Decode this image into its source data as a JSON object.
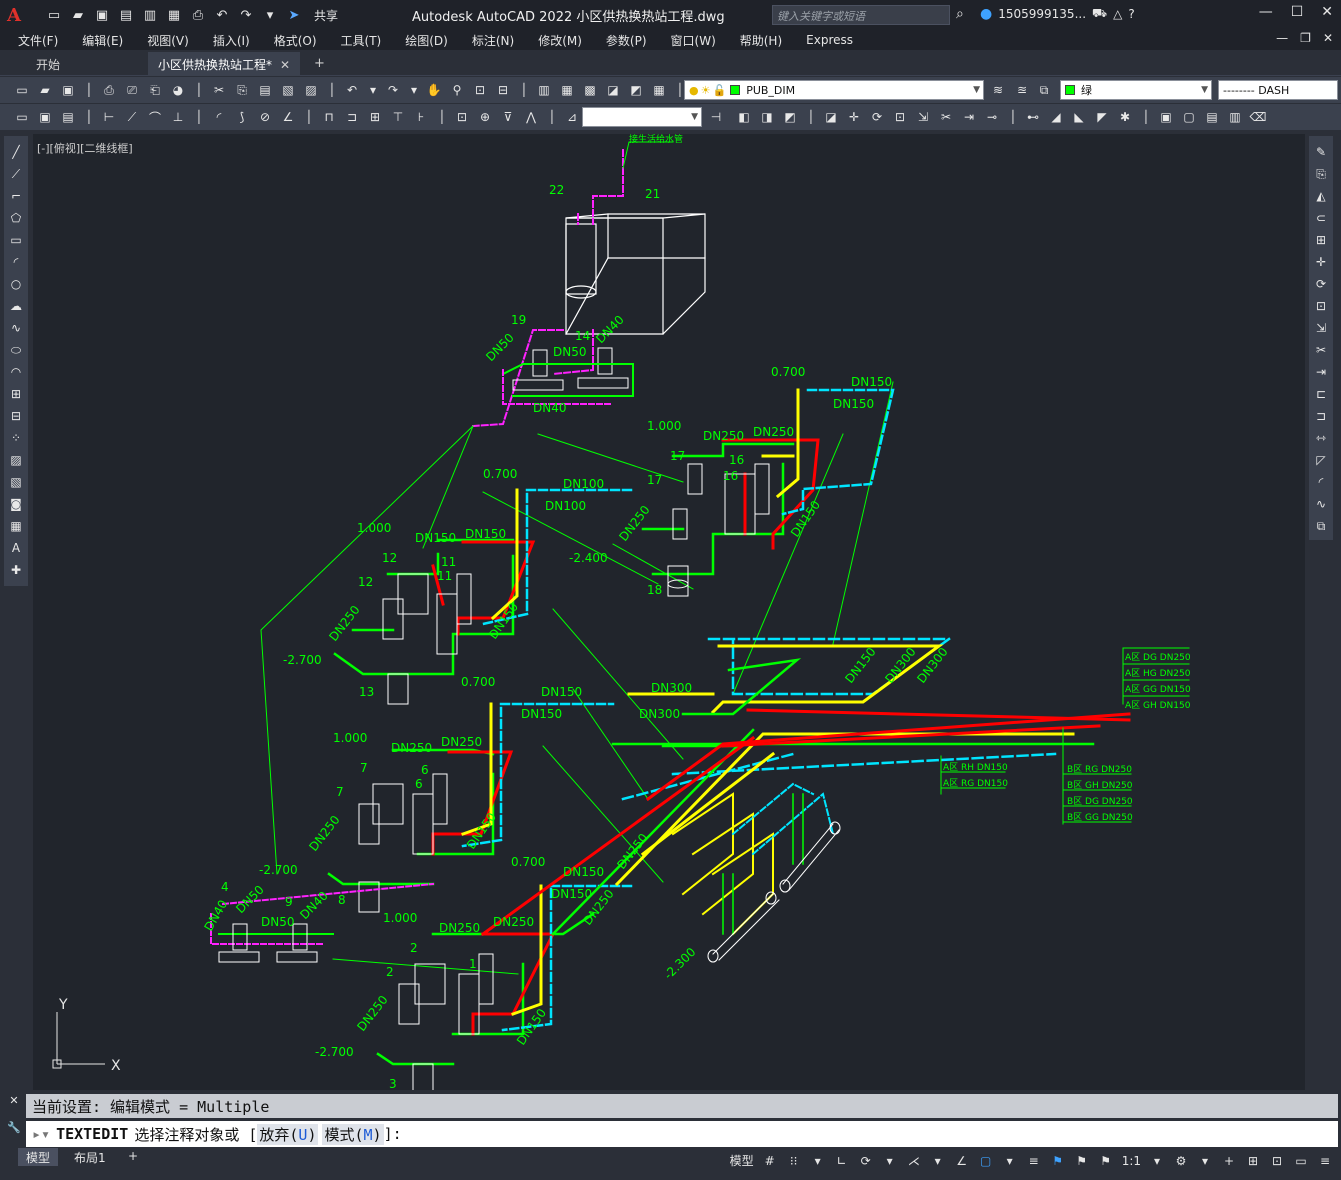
{
  "app": {
    "logo": "A",
    "title": "Autodesk AutoCAD 2022    小区供热换热站工程.dwg",
    "share_label": "共享",
    "search_placeholder": "键入关键字或短语",
    "user": "1505999135...",
    "win_minimize": "—",
    "win_maximize": "☐",
    "win_close": "✕"
  },
  "menu": {
    "items": [
      "文件(F)",
      "编辑(E)",
      "视图(V)",
      "插入(I)",
      "格式(O)",
      "工具(T)",
      "绘图(D)",
      "标注(N)",
      "修改(M)",
      "参数(P)",
      "窗口(W)",
      "帮助(H)",
      "Express"
    ]
  },
  "tabs": {
    "start": "开始",
    "active": "小区供热换热站工程*",
    "close": "✕",
    "add": "+"
  },
  "toolbar": {
    "layer": "PUB_DIM",
    "color": "绿",
    "linetype": "-------- DASH",
    "dimstyle": "",
    "colors": {
      "green": "#00ff00"
    }
  },
  "canvas": {
    "view_label": "[-][俯视][二维线框]",
    "ucs_x": "X",
    "ucs_y": "Y"
  },
  "drawing_labels": {
    "top_note": "接生活给水管",
    "n21": "21",
    "n22": "22",
    "n19": "19",
    "n14": "14",
    "dn50_a": "DN50",
    "dn50_b": "DN50",
    "dn40_a": "DN40",
    "dn40_b": "DN40",
    "e0700_a": "0.700",
    "dn150_a": "DN150",
    "dn150_b": "DN150",
    "e1000_a": "1.000",
    "dn250_a": "DN250",
    "dn250_b": "DN250",
    "n17a": "17",
    "n16a": "16",
    "n17b": "17",
    "n16b": "16",
    "e0700_b": "0.700",
    "dn100_a": "DN100",
    "dn100_b": "DN100",
    "dn250_c": "DN250",
    "e2400": "-2.400",
    "n18": "18",
    "dn150_c": "DN150",
    "e1000_b": "1.000",
    "dn150_d": "DN150",
    "dn150_e": "DN150",
    "n12a": "12",
    "n11a": "11",
    "n12b": "12",
    "n11b": "11",
    "dn250_d": "DN250",
    "dn150_f": "DN150",
    "e2700_a": "-2.700",
    "n13": "13",
    "dn300_a": "DN300",
    "dn300_b": "DN300",
    "dn300_c": "DN300",
    "dn300_d": "DN300",
    "dn150_g": "DN150",
    "e0700_c": "0.700",
    "dn150_h": "DN150",
    "dn150_i": "DN150",
    "e1000_c": "1.000",
    "dn250_e": "DN250",
    "dn250_f": "DN250",
    "n7a": "7",
    "n6a": "6",
    "n7b": "7",
    "n6b": "6",
    "dn250_g": "DN250",
    "dn150_j": "DN150",
    "e2700_b": "-2.700",
    "n8": "8",
    "n4": "4",
    "n9": "9",
    "dn50_c": "DN50",
    "dn50_d": "DN50",
    "dn40_c": "DN40",
    "dn40_d": "DN40",
    "e0700_d": "0.700",
    "dn150_k": "DN150",
    "dn150_l": "DN150",
    "dn250_h": "DN250",
    "dn250_i": "DN250",
    "e1000_d": "1.000",
    "dn250_j": "DN250",
    "dn250_k": "DN250",
    "n2a": "2",
    "n1a": "1",
    "n2b": "2",
    "dn250_l": "DN250",
    "dn150_m": "DN150",
    "e2700_c": "-2.700",
    "n3": "3",
    "e2300": "-2.300",
    "legend_a1": "A区 DG DN250",
    "legend_a2": "A区 HG DN250",
    "legend_a3": "A区 GG DN150",
    "legend_a4": "A区 GH DN150",
    "legend_b1": "A区 RH DN150",
    "legend_b2": "A区 RG DN150",
    "legend_c1": "B区 RG DN250",
    "legend_c2": "B区 GH DN250",
    "legend_c3": "B区 DG DN250",
    "legend_c4": "B区 GG DN250"
  },
  "command": {
    "history": "当前设置: 编辑模式 = Multiple",
    "name": "TEXTEDIT",
    "prompt": "选择注释对象或 [",
    "opt1_label": "放弃(",
    "opt1_key": "U",
    "opt1_end": ")",
    "opt2_label": "模式(",
    "opt2_key": "M",
    "opt2_end": ")",
    "suffix": "]:"
  },
  "status": {
    "model_tab": "模型",
    "layout_tab": "布局1",
    "add": "+",
    "model_btn": "模型",
    "scale": "1:1"
  }
}
